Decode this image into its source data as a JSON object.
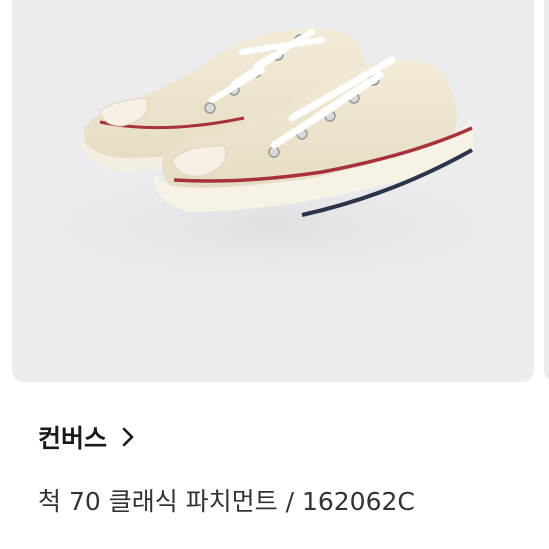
{
  "product": {
    "image_alt": "cream low-top sneakers",
    "icon": "chevron-right-icon",
    "brand": "컨버스",
    "name": "척 70 클래식 파치먼트 / 162062C"
  },
  "colors": {
    "card_bg": "#ececee",
    "brand_text": "#1a1a1a",
    "name_text": "#333333"
  }
}
